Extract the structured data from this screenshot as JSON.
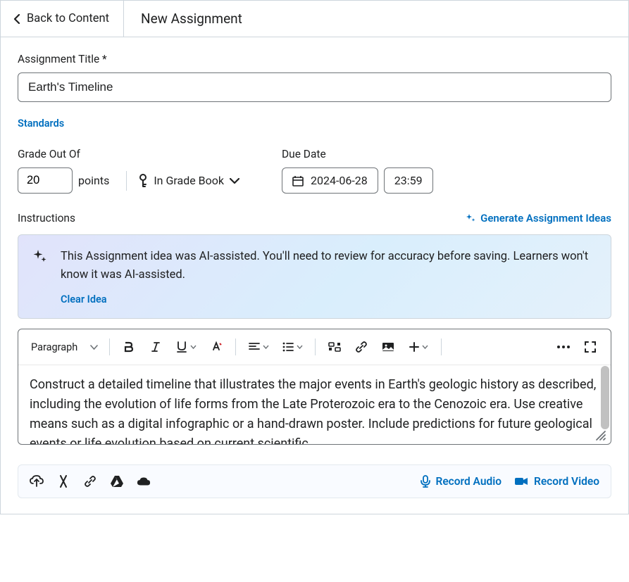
{
  "header": {
    "back_label": "Back to Content",
    "page_title": "New Assignment"
  },
  "assignment": {
    "title_label": "Assignment Title *",
    "title_value": "Earth's Timeline"
  },
  "standards_label": "Standards",
  "grade": {
    "label": "Grade Out Of",
    "value": "20",
    "points_label": "points",
    "gradebook_label": "In Grade Book"
  },
  "due": {
    "label": "Due Date",
    "date": "2024-06-28",
    "time": "23:59"
  },
  "instructions": {
    "label": "Instructions",
    "generate_label": "Generate Assignment Ideas"
  },
  "ai_notice": {
    "text": "This Assignment idea was AI-assisted. You'll need to review for accuracy before saving. Learners won't know it was AI-assisted.",
    "clear_label": "Clear Idea"
  },
  "editor": {
    "paragraph_label": "Paragraph",
    "content": "Construct a detailed timeline that illustrates the major events in Earth's geologic history as described, including the evolution of life forms from the Late Proterozoic era to the Cenozoic era. Use creative means such as a digital infographic or a hand-drawn poster. Include predictions for future geological events or life evolution based on current scientific"
  },
  "media": {
    "record_audio": "Record Audio",
    "record_video": "Record Video"
  }
}
